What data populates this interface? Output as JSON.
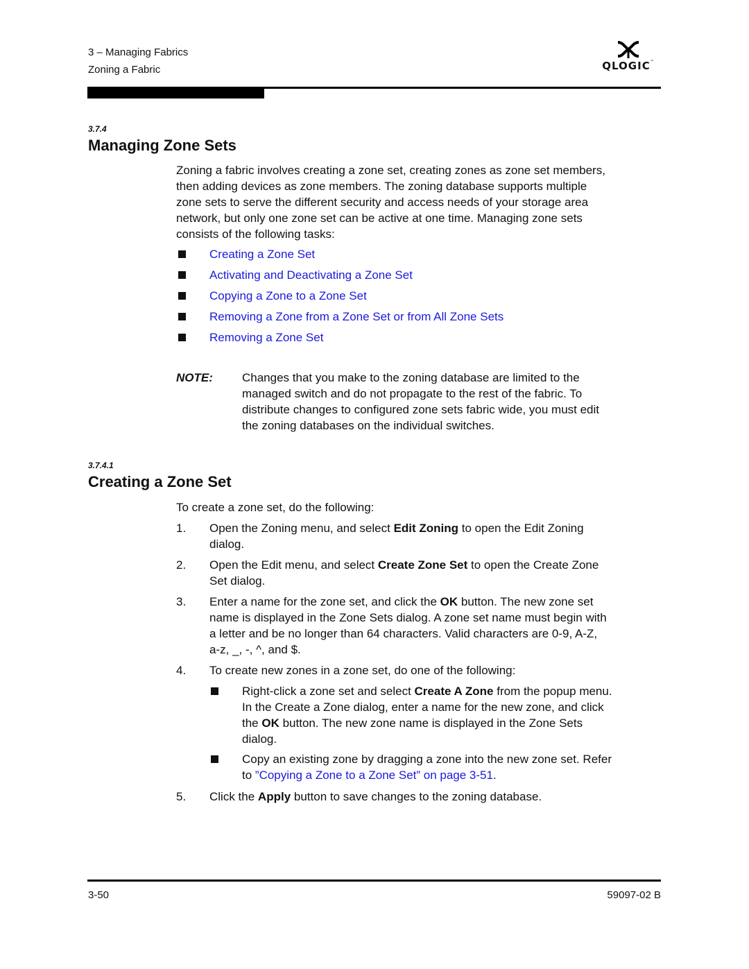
{
  "header": {
    "chapter": "3 – Managing Fabrics",
    "section": "Zoning a Fabric",
    "logo_text": "QLOGIC",
    "logo_icon": "qlogic-logo-icon"
  },
  "section_374": {
    "number": "3.7.4",
    "title": "Managing Zone Sets",
    "intro_lines": [
      "Zoning a fabric involves creating a zone set, creating zones as zone set members,",
      "then adding devices as zone members. The zoning database supports multiple",
      "zone sets to serve the different security and access needs of your storage area",
      "network, but only one zone set can be active at one time. Managing zone sets",
      "consists of the following tasks:"
    ],
    "tasks": [
      "Creating a Zone Set",
      "Activating and Deactivating a Zone Set",
      "Copying a Zone to a Zone Set",
      "Removing a Zone from a Zone Set or from All Zone Sets",
      "Removing a Zone Set"
    ],
    "note_label": "NOTE:",
    "note_lines": [
      "Changes that you make to the zoning database are limited to the",
      "managed switch and do not propagate to the rest of the fabric. To",
      "distribute changes to configured zone sets fabric wide, you must edit",
      "the zoning databases on the individual switches."
    ]
  },
  "section_3741": {
    "number": "3.7.4.1",
    "title": "Creating a Zone Set",
    "intro": "To create a zone set, do the following:",
    "steps": [
      {
        "num": "1.",
        "pre": "Open the Zoning menu, and select ",
        "bold": "Edit Zoning",
        "post": " to open the Edit Zoning",
        "line2": "dialog."
      },
      {
        "num": "2.",
        "pre": "Open the Edit menu, and select ",
        "bold": "Create Zone Set",
        "post": " to open the Create Zone",
        "line2": "Set dialog."
      },
      {
        "num": "3.",
        "pre": "Enter a name for the zone set, and click the ",
        "bold": "OK",
        "post": " button. The new zone set",
        "line2": "name is displayed in the Zone Sets dialog. A zone set name must begin with",
        "line3": "a letter and be no longer than 64 characters. Valid characters are 0-9, A-Z,",
        "line4": "a-z, _, -, ^, and $."
      },
      {
        "num": "4.",
        "text": "To create new zones in a zone set, do one of the following:"
      },
      {
        "num": "5.",
        "pre": "Click the ",
        "bold": "Apply",
        "post": " button to save changes to the zoning database."
      }
    ],
    "sub_bullets": [
      {
        "pre": "Right-click a zone set and select ",
        "bold": "Create A Zone",
        "post": " from the popup menu.",
        "line2": "In the Create a Zone dialog, enter a name for the new zone, and click",
        "line3_pre": "the ",
        "line3_bold": "OK",
        "line3_post": " button. The new zone name is displayed in the Zone Sets",
        "line4": "dialog."
      },
      {
        "line1": "Copy an existing zone by dragging a zone into the new zone set. Refer",
        "line2_pre": "to ",
        "line2_link": "”Copying a Zone to a Zone Set” on page 3-51",
        "line2_post": "."
      }
    ]
  },
  "footer": {
    "page_number": "3-50",
    "doc_number": "59097-02 B"
  },
  "colors": {
    "link": "#1a1adb",
    "text": "#111111"
  }
}
